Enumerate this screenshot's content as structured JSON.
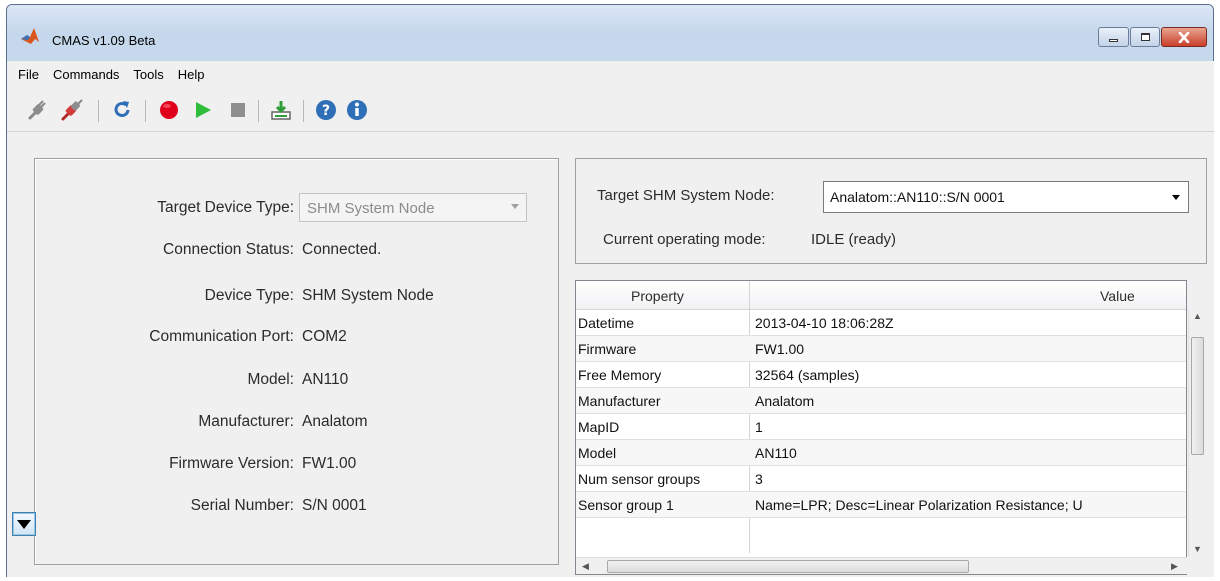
{
  "window": {
    "title": "CMAS v1.09 Beta"
  },
  "menu": [
    "File",
    "Commands",
    "Tools",
    "Help"
  ],
  "toolbar": {
    "icons": [
      "disconnect-icon",
      "connect-icon",
      "refresh-icon",
      "record-icon",
      "play-icon",
      "stop-icon",
      "download-icon",
      "help-icon",
      "info-icon"
    ]
  },
  "device": {
    "target_type_label": "Target Device Type:",
    "target_type_value": "SHM System Node",
    "fields": [
      {
        "label": "Connection Status:",
        "value": "Connected."
      },
      {
        "label": "Device Type:",
        "value": "SHM System Node"
      },
      {
        "label": "Communication Port:",
        "value": "COM2"
      },
      {
        "label": "Model:",
        "value": "AN110"
      },
      {
        "label": "Manufacturer:",
        "value": "Analatom"
      },
      {
        "label": "Firmware Version:",
        "value": "FW1.00"
      },
      {
        "label": "Serial Number:",
        "value": "S/N 0001"
      }
    ]
  },
  "node": {
    "label": "Target SHM System Node:",
    "value": "Analatom::AN110::S/N 0001",
    "mode_label": "Current operating mode:",
    "mode_value": "IDLE   (ready)"
  },
  "table": {
    "headers": [
      "Property",
      "Value"
    ],
    "rows": [
      [
        "Datetime",
        "2013-04-10 18:06:28Z"
      ],
      [
        "Firmware",
        "FW1.00"
      ],
      [
        "Free Memory",
        "32564 (samples)"
      ],
      [
        "Manufacturer",
        "Analatom"
      ],
      [
        "MapID",
        "1"
      ],
      [
        "Model",
        "AN110"
      ],
      [
        "Num sensor groups",
        "3"
      ],
      [
        "Sensor group 1",
        "Name=LPR; Desc=Linear Polarization Resistance; U"
      ]
    ]
  },
  "colors": {
    "accent": "#3c7fb1",
    "record": "#e0001b",
    "play": "#2fbe3c",
    "close": "#c9402b"
  }
}
